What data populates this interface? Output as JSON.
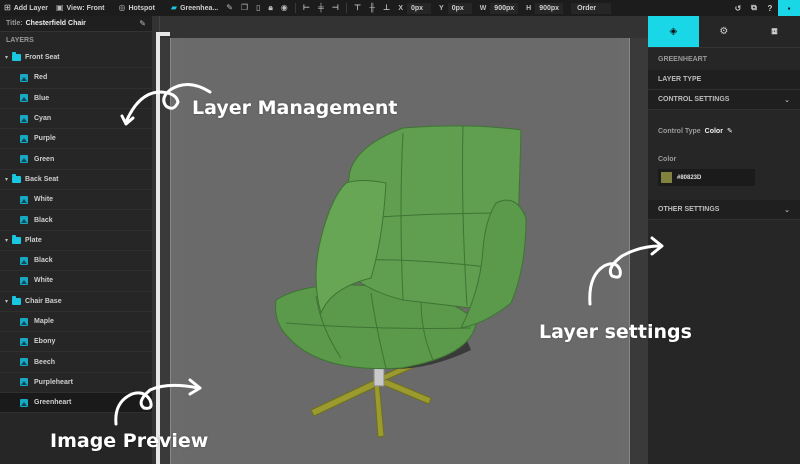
{
  "toolbar": {
    "add_layer": "Add Layer",
    "view": "View: Front",
    "hotspot": "Hotspot",
    "layer_name": "Greenhea...",
    "x_label": "X",
    "x_value": "0px",
    "y_label": "Y",
    "y_value": "0px",
    "w_label": "W",
    "w_value": "900px",
    "h_label": "H",
    "h_value": "900px",
    "order": "Order"
  },
  "left": {
    "title_label": "Title:",
    "title_value": "Chesterfield Chair",
    "layers_header": "LAYERS",
    "groups": [
      {
        "name": "Front Seat",
        "children": [
          "Red",
          "Blue",
          "Cyan",
          "Purple",
          "Green"
        ]
      },
      {
        "name": "Back Seat",
        "children": [
          "White",
          "Black"
        ]
      },
      {
        "name": "Plate",
        "children": [
          "Black",
          "White"
        ]
      },
      {
        "name": "Chair Base",
        "children": [
          "Maple",
          "Ebony",
          "Beech",
          "Purpleheart",
          "Greenheart"
        ]
      }
    ]
  },
  "right": {
    "layer_name": "GREENHEART",
    "layer_type": "LAYER TYPE",
    "control_settings": "CONTROL SETTINGS",
    "control_type_label": "Control Type",
    "control_type_value": "Color",
    "color_label": "Color",
    "color_hex": "#80823D",
    "other_settings": "OTHER SETTINGS"
  },
  "annotations": {
    "layer_management": "Layer Management",
    "image_preview": "Image Preview",
    "layer_settings": "Layer settings"
  },
  "colors": {
    "accent": "#19d7e6",
    "swatch": "#80823D",
    "chair": "#5a9a4a"
  }
}
